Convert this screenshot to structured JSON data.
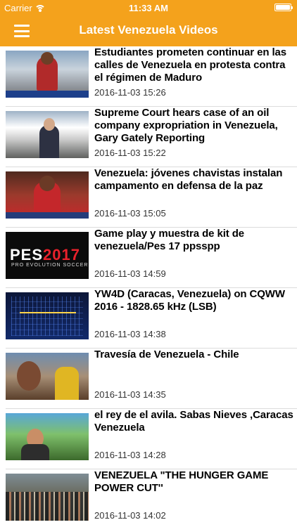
{
  "status_bar": {
    "carrier": "Carrier",
    "time": "11:33 AM",
    "wifi_icon": "wifi-icon",
    "battery_icon": "battery-icon"
  },
  "nav": {
    "title": "Latest Venezuela Videos",
    "menu_icon": "hamburger-menu-icon",
    "accent_color": "#f4a21c"
  },
  "videos": [
    {
      "title": "Estudiantes prometen continuar en las calles de Venezuela en protesta contra el régimen de Maduro",
      "date": "2016-11-03 15:26"
    },
    {
      "title": "Supreme Court hears case of an oil company expropriation in Venezuela, Gary Gately Reporting",
      "date": "2016-11-03 15:22"
    },
    {
      "title": "Venezuela: jóvenes chavistas instalan campamento en defensa de la paz",
      "date": "2016-11-03 15:05"
    },
    {
      "title": "Game play y muestra de kit de venezuela/Pes 17 ppsspp",
      "date": "2016-11-03 14:59"
    },
    {
      "title": "YW4D (Caracas, Venezuela) on CQWW 2016 - 1828.65 kHz (LSB)",
      "date": "2016-11-03 14:38"
    },
    {
      "title": "Travesía de Venezuela - Chile",
      "date": "2016-11-03 14:35"
    },
    {
      "title": "el rey de el avila. Sabas Nieves ,Caracas Venezuela",
      "date": "2016-11-03 14:28"
    },
    {
      "title": "VENEZUELA \"THE HUNGER GAME POWER CUT'' ",
      "date": "2016-11-03 14:02"
    }
  ],
  "thumb_text": {
    "pes_logo_a": "PES",
    "pes_logo_b": "2017",
    "pes_sub": "PRO EVOLUTION SOCCER"
  }
}
